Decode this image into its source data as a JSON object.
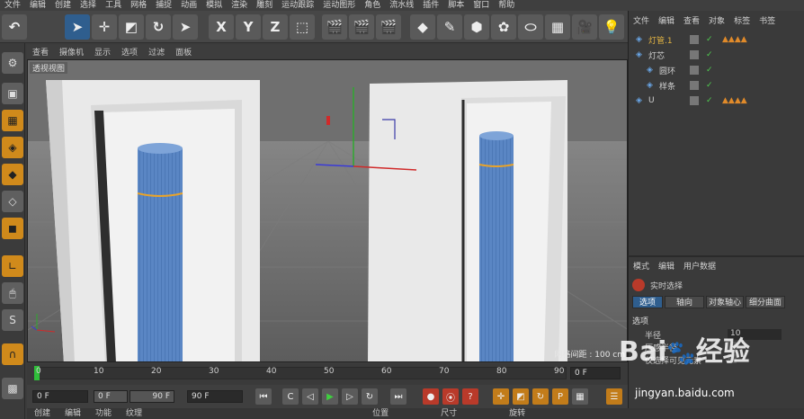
{
  "menu": [
    "文件",
    "编辑",
    "创建",
    "选择",
    "工具",
    "网格",
    "捕捉",
    "动画",
    "模拟",
    "渲染",
    "雕刻",
    "运动跟踪",
    "运动图形",
    "角色",
    "流水线",
    "插件",
    "脚本",
    "窗口",
    "帮助"
  ],
  "toolbar": {
    "x_label": "X",
    "y_label": "Y",
    "z_label": "Z"
  },
  "viewport": {
    "menu": [
      "查看",
      "摄像机",
      "显示",
      "选项",
      "过滤",
      "面板"
    ],
    "label": "透视视图",
    "grid_spacing": "网格间距 : 100 cm"
  },
  "timeline": {
    "ticks": [
      "0",
      "10",
      "20",
      "30",
      "40",
      "50",
      "60",
      "70",
      "80",
      "90"
    ],
    "current_frame": "0 F"
  },
  "transport": {
    "start": "0 F",
    "range_start": "0 F",
    "range_end": "90 F",
    "end": "90 F"
  },
  "bottom_tabs": [
    "创建",
    "编辑",
    "功能",
    "纹理"
  ],
  "bottom_right_tabs": [
    "位置",
    "尺寸",
    "旋转"
  ],
  "object_manager": {
    "tabs": [
      "文件",
      "编辑",
      "查看",
      "对象",
      "标签",
      "书签"
    ],
    "objects": [
      {
        "name": "灯管.1",
        "indent": 0,
        "color": "#e4b543"
      },
      {
        "name": "灯芯",
        "indent": 0,
        "color": "#d0d0d0"
      },
      {
        "name": "圆环",
        "indent": 1,
        "color": "#d0d0d0"
      },
      {
        "name": "样条",
        "indent": 1,
        "color": "#d0d0d0"
      },
      {
        "name": "U",
        "indent": 0,
        "color": "#d0d0d0"
      }
    ]
  },
  "attributes": {
    "tabs": [
      "模式",
      "编辑",
      "用户数据"
    ],
    "tool_name": "实时选择",
    "subtabs": [
      "选项",
      "轴向",
      "对象轴心",
      "细分曲面"
    ],
    "section": "选项",
    "fields": [
      {
        "label": "半径",
        "value": "10"
      },
      {
        "label": "压感半径",
        "value": ""
      },
      {
        "label": "仅选择可见元素",
        "value": ""
      }
    ]
  },
  "watermark": {
    "text": "Bai du 经验",
    "url": "jingyan.baidu.com"
  },
  "colors": {
    "accent": "#2f5e8e",
    "orange": "#d08a1b",
    "tube": "#5a86c4"
  }
}
